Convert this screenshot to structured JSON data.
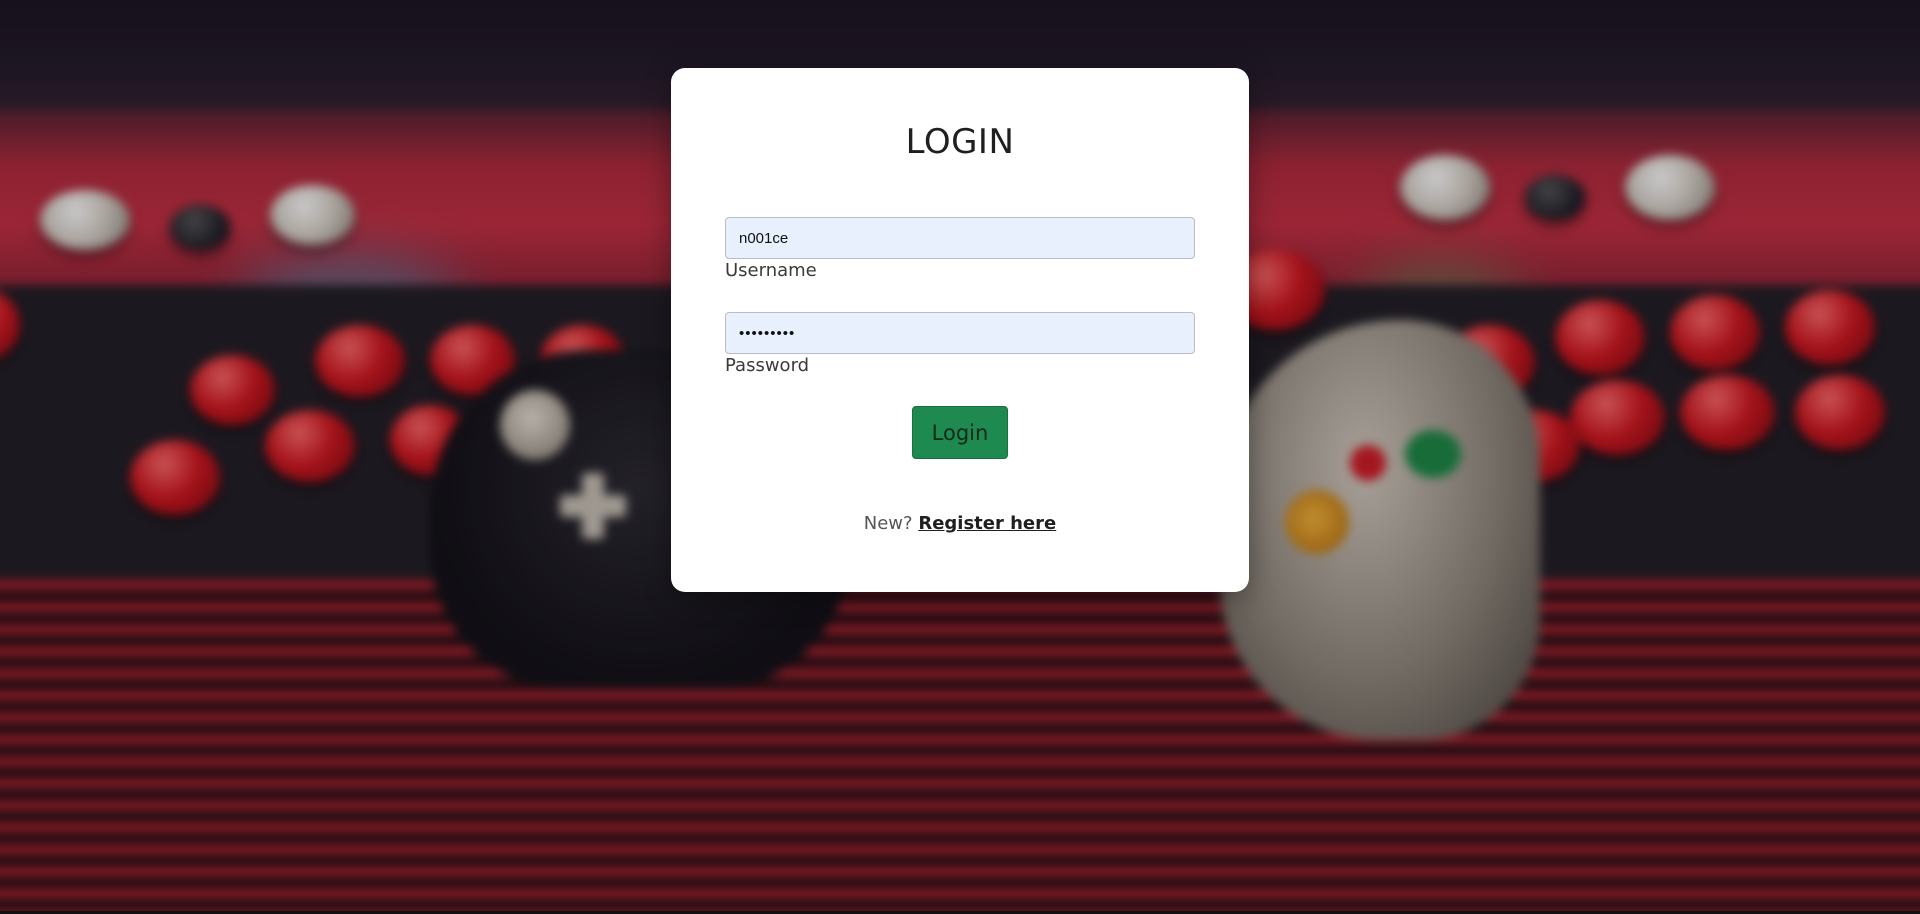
{
  "login": {
    "title": "LOGIN",
    "username": {
      "value": "n001ce",
      "label": "Username"
    },
    "password": {
      "value": "•••••••••",
      "label": "Password"
    },
    "submit_label": "Login",
    "register_prompt": "New?",
    "register_link": "Register here"
  },
  "colors": {
    "card_background": "#ffffff",
    "input_background": "#e8f0fe",
    "login_button": "#1e8a50",
    "text_dark": "#1f1f1f"
  },
  "background": {
    "description_icon": "arcade-controller-background"
  }
}
